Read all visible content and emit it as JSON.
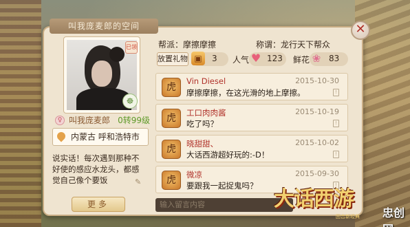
{
  "title": "叫我庞麦郎的空间",
  "profile": {
    "name": "叫我庞麦郎",
    "level": "0转99级",
    "location": "内蒙古  呼和浩特市",
    "bio": "说实话！每次遇到那种不好使的感应水龙头，都感觉自己像个要饭",
    "more_label": "更多",
    "gift_badge": "已领"
  },
  "info": {
    "faction_label": "帮派：摩擦摩擦",
    "title_label": "称谓：龙行天下帮众"
  },
  "stats": {
    "gift_button": "放置礼物",
    "gift_count": "3",
    "popularity_label": "人气",
    "popularity_count": "123",
    "flower_label": "鲜花",
    "flower_count": "83"
  },
  "messages": [
    {
      "name": "Vin Diesel",
      "text": "摩擦摩擦，在这光滑的地上摩擦。",
      "date": "2015-10-30"
    },
    {
      "name": "工口肉肉酱",
      "text": "吃了吗？",
      "date": "2015-10-19"
    },
    {
      "name": "晓甜甜、",
      "text": "大话西游超好玩的:-D！",
      "date": "2015-10-02"
    },
    {
      "name": "微凉",
      "text": "要跟我一起捉鬼吗？",
      "date": "2015-09-30"
    }
  ],
  "input_placeholder": "输入留言内容",
  "logo": {
    "title": "大话西游",
    "subtitle": "回合新经典"
  },
  "watermark": "忠创网",
  "icons": {
    "close": "close-icon",
    "gift": "gift-box-icon",
    "heart": "heart-icon",
    "flower": "lotus-icon",
    "location": "location-pin-icon",
    "gender": "female-icon",
    "edit": "edit-icon"
  },
  "colors": {
    "panel_bg": "#efe4d0",
    "name_red": "#b0322a",
    "level_green": "#5f9a2a"
  }
}
